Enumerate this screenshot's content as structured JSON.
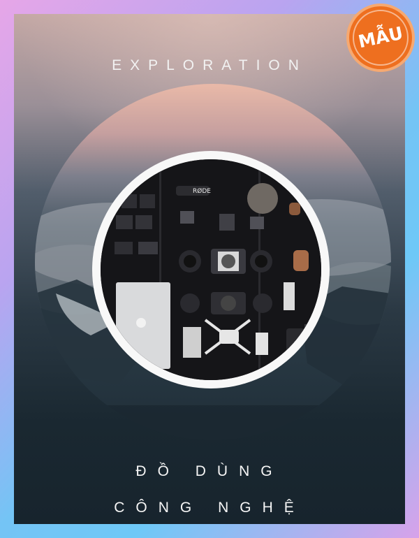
{
  "poster": {
    "top_title": "EXPLORATION",
    "bottom_title_line1": "ĐỒ DÙNG",
    "bottom_title_line2": "CÔNG NGHỆ"
  },
  "badge": {
    "label": "MẪU",
    "color": "#ee6f1f"
  },
  "photo": {
    "brand_label": "RØDE"
  }
}
